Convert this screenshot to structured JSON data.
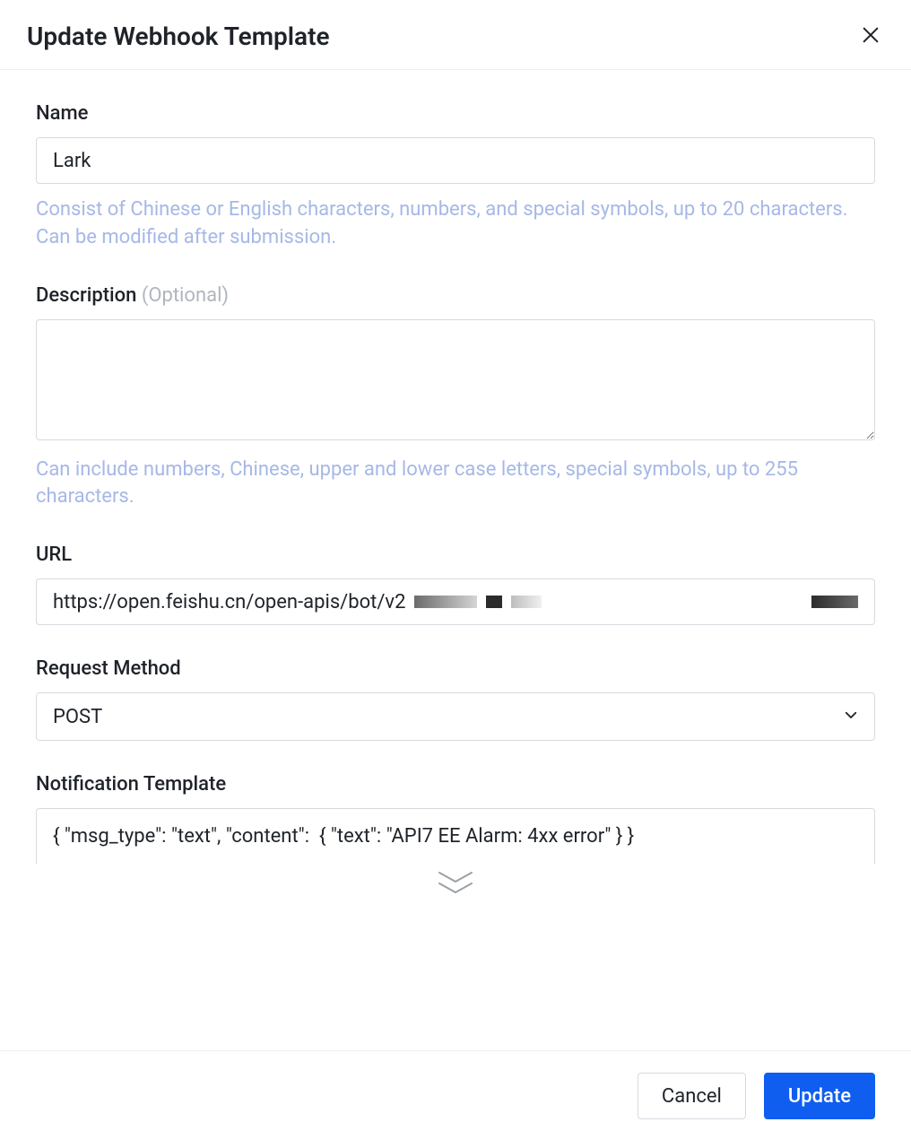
{
  "header": {
    "title": "Update Webhook Template"
  },
  "form": {
    "name": {
      "label": "Name",
      "value": "Lark",
      "hint": "Consist of Chinese or English characters, numbers, and special symbols, up to 20 characters. Can be modified after submission."
    },
    "description": {
      "label": "Description",
      "optional": "(Optional)",
      "value": "",
      "hint": "Can include numbers, Chinese, upper and lower case letters, special symbols, up to 255 characters."
    },
    "url": {
      "label": "URL",
      "value": "https://open.feishu.cn/open-apis/bot/v2"
    },
    "method": {
      "label": "Request Method",
      "value": "POST"
    },
    "template": {
      "label": "Notification Template",
      "value": "{ \"msg_type\": \"text\", \"content\":  { \"text\": \"API7 EE Alarm: 4xx error\" } }"
    }
  },
  "footer": {
    "cancel": "Cancel",
    "submit": "Update"
  }
}
